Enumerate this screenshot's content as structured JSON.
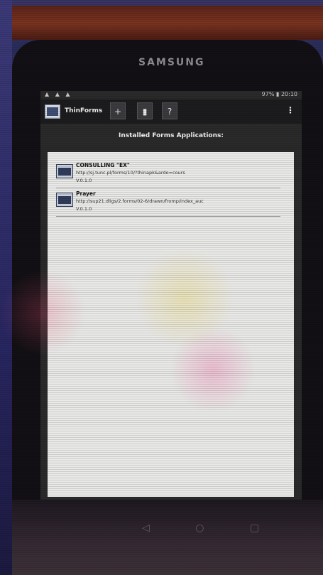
{
  "device": {
    "brand": "SAMSUNG"
  },
  "statusbar": {
    "left_icons": "▲ ▲ ▲",
    "right": "97% ▮ 20:10"
  },
  "actionbar": {
    "app_title": "ThinForms",
    "buttons": [
      "+",
      "▮",
      "?"
    ],
    "overflow": "⋮"
  },
  "main": {
    "header": "Installed Forms Applications:",
    "items": [
      {
        "name": "CONSULLING \"EX\"",
        "url": "http://sj.tunc.pl/forms/10/?thinapk&ardo=cours",
        "version": "V.0.1.0"
      },
      {
        "name": "Prayer",
        "url": "http://sup21.dligs/2.forms/02-6/drawn/fromp/index_auc",
        "version": "V.0.1.0"
      }
    ]
  }
}
